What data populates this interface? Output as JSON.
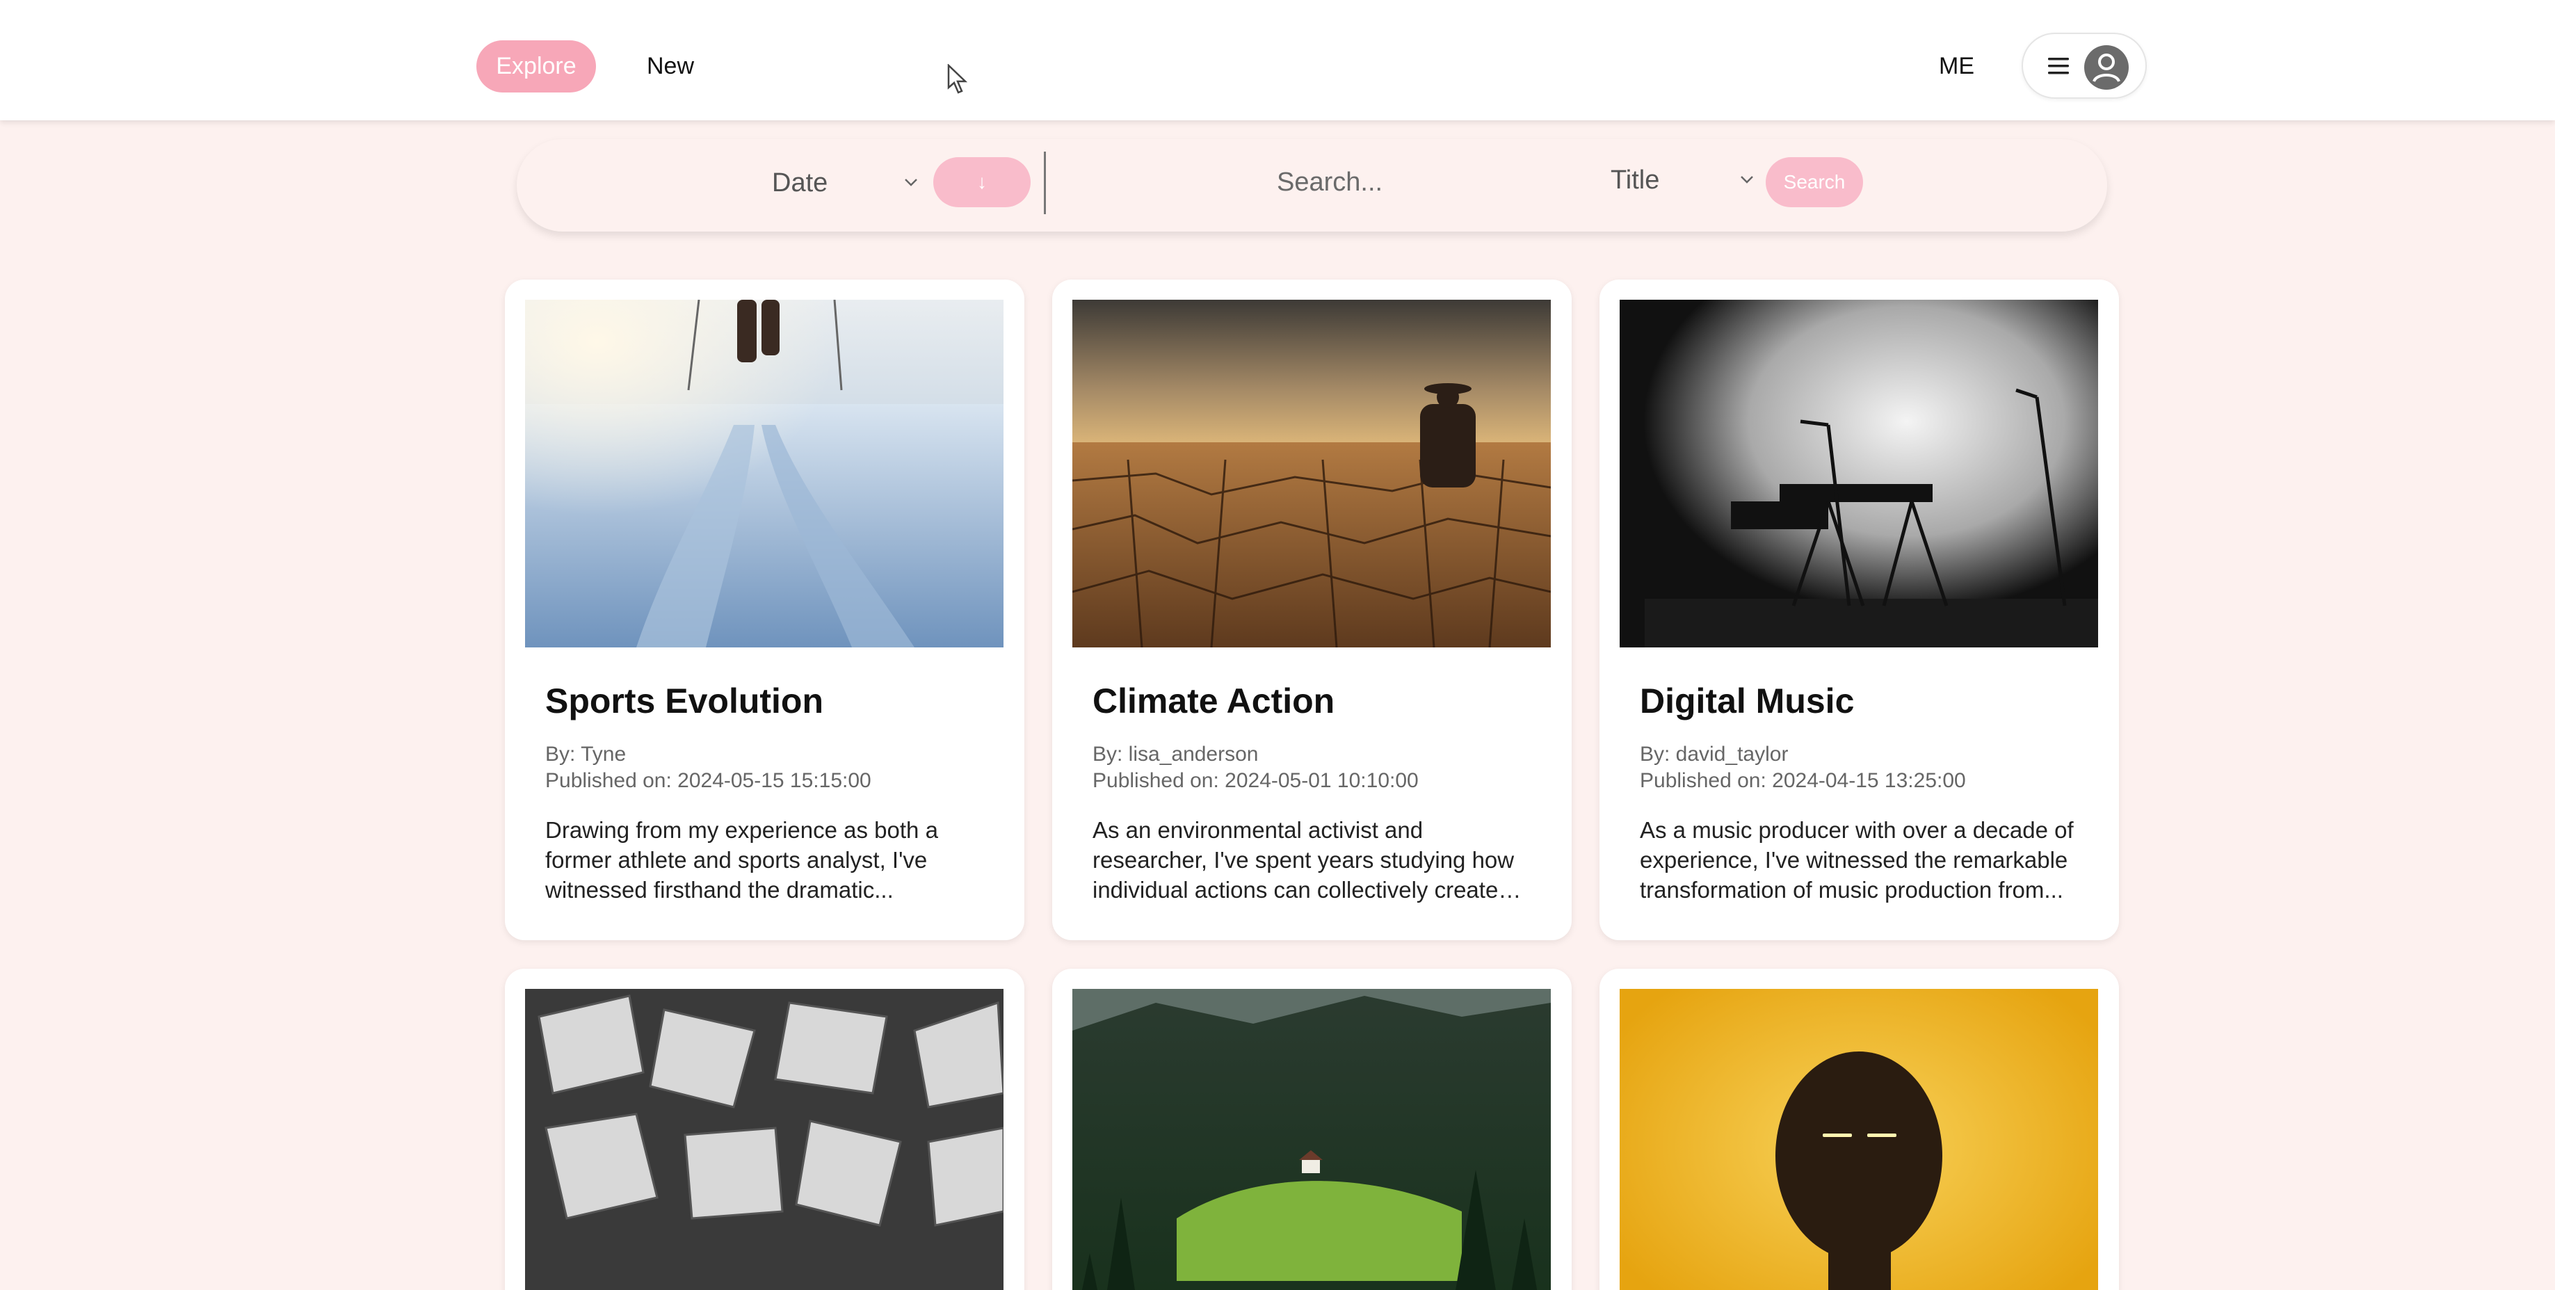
{
  "nav": {
    "explore_label": "Explore",
    "new_label": "New",
    "me_label": "ME"
  },
  "filters": {
    "sort_value": "Date",
    "order_label": "↓",
    "search_placeholder": "Search...",
    "field_value": "Title",
    "search_button_label": "Search"
  },
  "colors": {
    "accent": "#f7a7b8",
    "background": "#fdf1ef"
  },
  "cards": [
    {
      "title": "Sports Evolution",
      "author": "By: Tyne",
      "published": "Published on: 2024-05-15 15:15:00",
      "excerpt": "Drawing from my experience as both a former athlete and sports analyst, I've witnessed firsthand the dramatic...",
      "image": "snow-trail-photo"
    },
    {
      "title": "Climate Action",
      "author": "By: lisa_anderson",
      "published": "Published on: 2024-05-01 10:10:00",
      "excerpt": "As an environmental activist and researcher, I've spent years studying how individual actions can collectively create significant...",
      "image": "cracked-earth-photo"
    },
    {
      "title": "Digital Music",
      "author": "By: david_taylor",
      "published": "Published on: 2024-04-15 13:25:00",
      "excerpt": "As a music producer with over a decade of experience, I've witnessed the remarkable transformation of music production from...",
      "image": "stage-keyboard-photo"
    },
    {
      "image": "open-books-photo"
    },
    {
      "image": "forest-valley-photo"
    },
    {
      "image": "glowing-eyes-portrait-photo"
    }
  ]
}
